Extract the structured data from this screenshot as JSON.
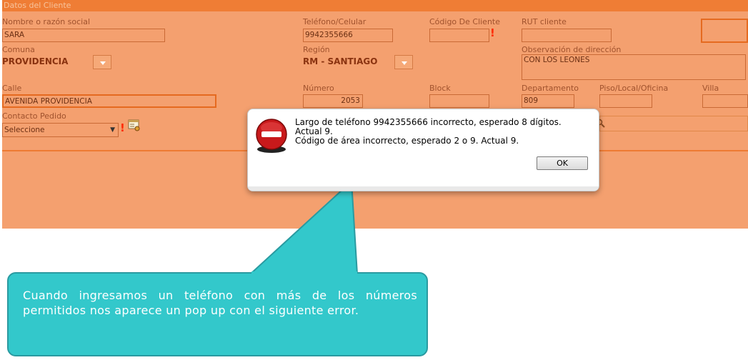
{
  "panel": {
    "header": "Datos del Cliente",
    "labels": {
      "nombre": "Nombre o razón social",
      "telefono": "Teléfono/Celular",
      "codigo_cliente": "Código De Cliente",
      "rut": "RUT cliente",
      "comuna": "Comuna",
      "region": "Región",
      "observacion": "Observación de dirección",
      "calle": "Calle",
      "numero": "Número",
      "block": "Block",
      "departamento": "Departamento",
      "piso": "Piso/Local/Oficina",
      "villa": "Villa",
      "contacto": "Contacto Pedido"
    },
    "values": {
      "nombre": "SARA",
      "telefono": "9942355666",
      "codigo_cliente": "",
      "rut": "",
      "comuna": "PROVIDENCIA",
      "region": "RM - SANTIAGO",
      "observacion": "CON LOS LEONES",
      "calle": "AVENIDA PROVIDENCIA",
      "numero": "2053",
      "block": "",
      "departamento": "809",
      "piso": "",
      "villa": "",
      "contacto": "Seleccione"
    },
    "excl": "!"
  },
  "dialog": {
    "line1": "Largo de teléfono 9942355666 incorrecto, esperado 8 dígitos.",
    "line2": "Actual 9.",
    "line3": "Código de área incorrecto, esperado 2 o 9. Actual 9.",
    "ok_label": "OK"
  },
  "callout": {
    "text": "Cuando ingresamos un teléfono con más de los números permitidos nos aparece un pop up con el siguiente error."
  },
  "colors": {
    "panel_bg": "#f4a06f",
    "header_bg": "#ef7d35",
    "callout_bg": "#33c8cb"
  },
  "icons": [
    "stop-error-icon",
    "dropdown-arrow-icon",
    "contact-card-icon",
    "search-icon"
  ]
}
